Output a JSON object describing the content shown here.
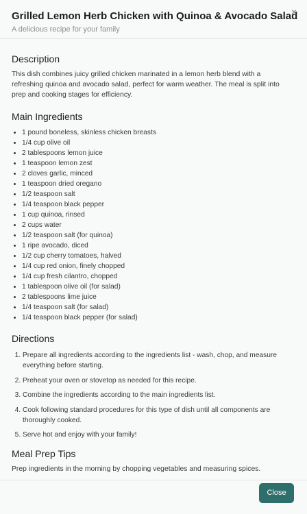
{
  "modal": {
    "title": "Grilled Lemon Herb Chicken with Quinoa & Avocado Salad",
    "subtitle": "A delicious recipe for your family",
    "close_icon": "×"
  },
  "description": {
    "heading": "Description",
    "text": "This dish combines juicy grilled chicken marinated in a lemon herb blend with a refreshing quinoa and avocado salad, perfect for warm weather. The meal is split into prep and cooking stages for efficiency."
  },
  "ingredients": {
    "heading": "Main Ingredients",
    "items": [
      "1 pound boneless, skinless chicken breasts",
      "1/4 cup olive oil",
      "2 tablespoons lemon juice",
      "1 teaspoon lemon zest",
      "2 cloves garlic, minced",
      "1 teaspoon dried oregano",
      "1/2 teaspoon salt",
      "1/4 teaspoon black pepper",
      "1 cup quinoa, rinsed",
      "2 cups water",
      "1/2 teaspoon salt (for quinoa)",
      "1 ripe avocado, diced",
      "1/2 cup cherry tomatoes, halved",
      "1/4 cup red onion, finely chopped",
      "1/4 cup fresh cilantro, chopped",
      "1 tablespoon olive oil (for salad)",
      "2 tablespoons lime juice",
      "1/4 teaspoon salt (for salad)",
      "1/4 teaspoon black pepper (for salad)"
    ]
  },
  "directions": {
    "heading": "Directions",
    "steps": [
      "Prepare all ingredients according to the ingredients list - wash, chop, and measure everything before starting.",
      "Preheat your oven or stovetop as needed for this recipe.",
      "Combine the ingredients according to the main ingredients list.",
      "Cook following standard procedures for this type of dish until all components are thoroughly cooked.",
      "Serve hot and enjoy with your family!"
    ]
  },
  "tips": {
    "heading": "Meal Prep Tips",
    "text": "Prep ingredients in the morning by chopping vegetables and measuring spices."
  },
  "footer": {
    "close_label": "Close"
  },
  "colors": {
    "accent": "#2e6e6b"
  }
}
